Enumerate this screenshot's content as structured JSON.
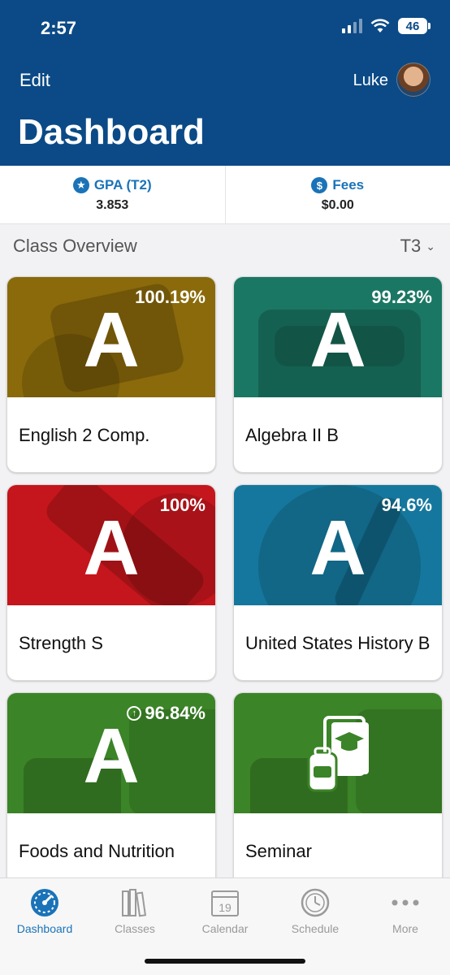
{
  "status": {
    "time": "2:57",
    "battery": "46"
  },
  "header": {
    "edit_label": "Edit",
    "user_name": "Luke",
    "title": "Dashboard"
  },
  "summary": {
    "gpa": {
      "label": "GPA (T2)",
      "value": "3.853",
      "icon": "star-icon"
    },
    "fees": {
      "label": "Fees",
      "value": "$0.00",
      "icon": "dollar-icon"
    }
  },
  "overview": {
    "title": "Class Overview",
    "term": "T3"
  },
  "classes": [
    {
      "name": "English 2 Comp.",
      "grade": "A",
      "percent": "100.19%",
      "color": "#8a6a0b",
      "trend": false
    },
    {
      "name": "Algebra II B",
      "grade": "A",
      "percent": "99.23%",
      "color": "#1a7763",
      "trend": false
    },
    {
      "name": "Strength S",
      "grade": "A",
      "percent": "100%",
      "color": "#c4161c",
      "trend": false
    },
    {
      "name": "United States History B",
      "grade": "A",
      "percent": "94.6%",
      "color": "#15779d",
      "trend": false
    },
    {
      "name": "Foods and Nutrition",
      "grade": "A",
      "percent": "96.84%",
      "color": "#3b8427",
      "trend": true
    },
    {
      "name": "Seminar",
      "grade": "",
      "percent": "",
      "color": "#3b8427",
      "trend": false
    }
  ],
  "tabs": [
    {
      "label": "Dashboard",
      "icon": "speedometer-icon",
      "active": true
    },
    {
      "label": "Classes",
      "icon": "books-icon",
      "active": false
    },
    {
      "label": "Calendar",
      "icon": "calendar-icon",
      "active": false,
      "day": "19"
    },
    {
      "label": "Schedule",
      "icon": "clock-icon",
      "active": false
    },
    {
      "label": "More",
      "icon": "ellipsis-icon",
      "active": false
    }
  ]
}
